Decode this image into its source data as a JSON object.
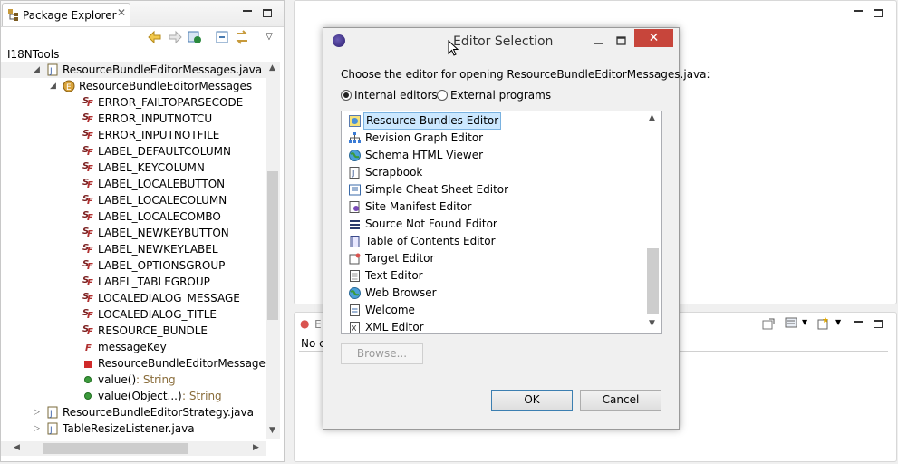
{
  "package_explorer": {
    "tab_label": "Package Explorer",
    "tab_close": "✕",
    "project": "I18NTools",
    "tree": [
      {
        "label": "ResourceBundleEditorMessages.java",
        "level": 1,
        "expanded": true,
        "icon": "java-file-icon"
      },
      {
        "label": "ResourceBundleEditorMessages",
        "level": 2,
        "expanded": true,
        "icon": "class-icon"
      },
      {
        "label": "ERROR_FAILTOPARSECODE",
        "level": 3,
        "icon": "static-final-field-icon"
      },
      {
        "label": "ERROR_INPUTNOTCU",
        "level": 3,
        "icon": "static-final-field-icon"
      },
      {
        "label": "ERROR_INPUTNOTFILE",
        "level": 3,
        "icon": "static-final-field-icon"
      },
      {
        "label": "LABEL_DEFAULTCOLUMN",
        "level": 3,
        "icon": "static-final-field-icon"
      },
      {
        "label": "LABEL_KEYCOLUMN",
        "level": 3,
        "icon": "static-final-field-icon"
      },
      {
        "label": "LABEL_LOCALEBUTTON",
        "level": 3,
        "icon": "static-final-field-icon"
      },
      {
        "label": "LABEL_LOCALECOLUMN",
        "level": 3,
        "icon": "static-final-field-icon"
      },
      {
        "label": "LABEL_LOCALECOMBO",
        "level": 3,
        "icon": "static-final-field-icon"
      },
      {
        "label": "LABEL_NEWKEYBUTTON",
        "level": 3,
        "icon": "static-final-field-icon"
      },
      {
        "label": "LABEL_NEWKEYLABEL",
        "level": 3,
        "icon": "static-final-field-icon"
      },
      {
        "label": "LABEL_OPTIONSGROUP",
        "level": 3,
        "icon": "static-final-field-icon"
      },
      {
        "label": "LABEL_TABLEGROUP",
        "level": 3,
        "icon": "static-final-field-icon"
      },
      {
        "label": "LOCALEDIALOG_MESSAGE",
        "level": 3,
        "icon": "static-final-field-icon"
      },
      {
        "label": "LOCALEDIALOG_TITLE",
        "level": 3,
        "icon": "static-final-field-icon"
      },
      {
        "label": "RESOURCE_BUNDLE",
        "level": 3,
        "icon": "static-final-field-icon"
      },
      {
        "label": "messageKey",
        "level": 3,
        "icon": "final-field-icon"
      },
      {
        "label": "ResourceBundleEditorMessages(Str",
        "level": 3,
        "icon": "constructor-icon"
      },
      {
        "label": "value()",
        "suffix": " : String",
        "level": 3,
        "icon": "method-icon"
      },
      {
        "label": "value(Object...)",
        "suffix": " : String",
        "level": 3,
        "icon": "method-icon"
      },
      {
        "label": "ResourceBundleEditorStrategy.java",
        "level": 1,
        "expanded": false,
        "icon": "java-file-icon"
      },
      {
        "label": "TableResizeListener.java",
        "level": 1,
        "expanded": false,
        "icon": "java-file-icon"
      }
    ]
  },
  "bottom_panel": {
    "tab_text": "E",
    "content_text": "No c"
  },
  "dialog": {
    "title": "Editor Selection",
    "close_glyph": "✕",
    "prompt": "Choose the editor for opening ResourceBundleEditorMessages.java:",
    "radio_internal": "Internal editors",
    "radio_external": "External programs",
    "selected_radio": "internal",
    "editors": [
      {
        "label": "Resource Bundles Editor",
        "icon": "resource-bundle-icon",
        "selected": true
      },
      {
        "label": "Revision Graph Editor",
        "icon": "graph-icon"
      },
      {
        "label": "Schema HTML Viewer",
        "icon": "globe-icon"
      },
      {
        "label": "Scrapbook",
        "icon": "scrapbook-icon"
      },
      {
        "label": "Simple Cheat Sheet Editor",
        "icon": "cheatsheet-icon"
      },
      {
        "label": "Site Manifest Editor",
        "icon": "manifest-icon"
      },
      {
        "label": "Source Not Found Editor",
        "icon": "list-icon"
      },
      {
        "label": "Table of Contents Editor",
        "icon": "book-icon"
      },
      {
        "label": "Target Editor",
        "icon": "target-icon"
      },
      {
        "label": "Text Editor",
        "icon": "text-file-icon"
      },
      {
        "label": "Web Browser",
        "icon": "globe-icon"
      },
      {
        "label": "Welcome",
        "icon": "welcome-icon"
      },
      {
        "label": "XML Editor",
        "icon": "xml-icon"
      }
    ],
    "browse_label": "Browse...",
    "ok_label": "OK",
    "cancel_label": "Cancel"
  }
}
